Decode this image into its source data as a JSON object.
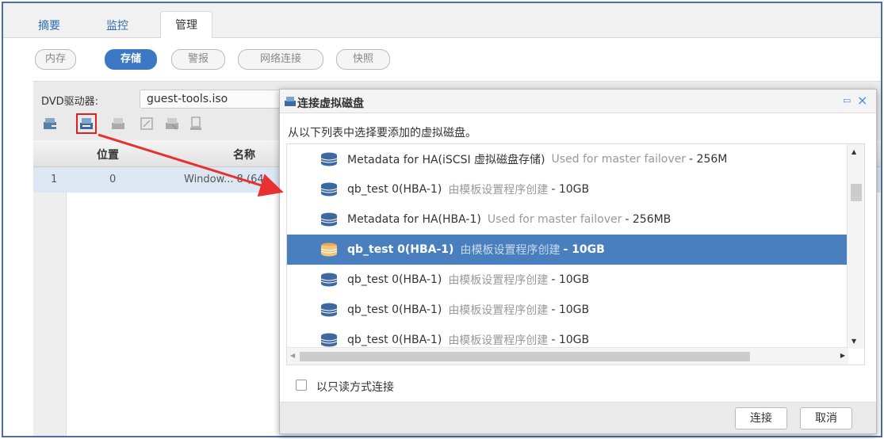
{
  "top_tabs": [
    {
      "label": "摘要"
    },
    {
      "label": "监控"
    },
    {
      "label": "管理"
    }
  ],
  "sub_tabs": [
    {
      "label": "内存"
    },
    {
      "label": "存储"
    },
    {
      "label": "警报"
    },
    {
      "label": "网络连接"
    },
    {
      "label": "快照"
    }
  ],
  "storage": {
    "dvd_label": "DVD驱动器:",
    "dvd_value": "guest-tools.iso",
    "toolbar_icons": [
      "add-disk-icon",
      "attach-disk-icon",
      "detach-disk-icon",
      "edit-disk-icon",
      "remove-disk-icon",
      "properties-icon"
    ],
    "columns": [
      "位置",
      "名称"
    ],
    "rows": [
      {
        "index": "1",
        "position": "0",
        "name": "Window... 8 (64"
      }
    ]
  },
  "dialog": {
    "title": "连接虚拟磁盘",
    "instruction": "从以下列表中选择要添加的虚拟磁盘。",
    "items": [
      {
        "name": "Metadata for HA(iSCSI 虚拟磁盘存储)",
        "desc": "Used for master failover",
        "size": "- 256M"
      },
      {
        "name": "qb_test 0(HBA-1)",
        "desc": "由模板设置程序创建",
        "size": "- 10GB"
      },
      {
        "name": "Metadata for HA(HBA-1)",
        "desc": "Used for master failover",
        "size": "- 256MB"
      },
      {
        "name": "qb_test 0(HBA-1)",
        "desc": "由模板设置程序创建",
        "size": "- 10GB"
      },
      {
        "name": "qb_test 0(HBA-1)",
        "desc": "由模板设置程序创建",
        "size": "- 10GB"
      },
      {
        "name": "qb_test 0(HBA-1)",
        "desc": "由模板设置程序创建",
        "size": "- 10GB"
      },
      {
        "name": "qb_test 0(HBA-1)",
        "desc": "由模板设置程序创建",
        "size": "- 10GB"
      }
    ],
    "selected_index": 3,
    "readonly_label": "以只读方式连接",
    "readonly_checked": false,
    "connect_label": "连接",
    "cancel_label": "取消"
  },
  "colors": {
    "accent": "#3d78c4",
    "selected_row": "#4a7fbf",
    "annotation_red": "#e02020"
  }
}
